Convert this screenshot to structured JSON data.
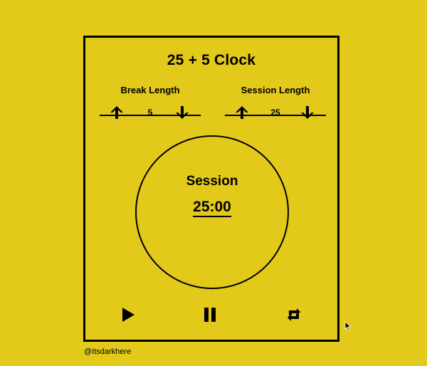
{
  "app": {
    "title": "25 + 5 Clock",
    "background_color": "#e2c91a",
    "foreground_color": "#000000"
  },
  "break": {
    "label": "Break Length",
    "value": "5",
    "increment_icon": "arrow-up-icon",
    "decrement_icon": "arrow-down-icon"
  },
  "session": {
    "label": "Session Length",
    "value": "25",
    "increment_icon": "arrow-up-icon",
    "decrement_icon": "arrow-down-icon"
  },
  "timer": {
    "label": "Session",
    "time": "25:00"
  },
  "controls": {
    "play_icon": "play-icon",
    "pause_icon": "pause-icon",
    "reset_icon": "repeat-icon"
  },
  "footer": {
    "credit": "@Itsdarkhere"
  },
  "cursor_icon": "mouse-pointer-icon"
}
